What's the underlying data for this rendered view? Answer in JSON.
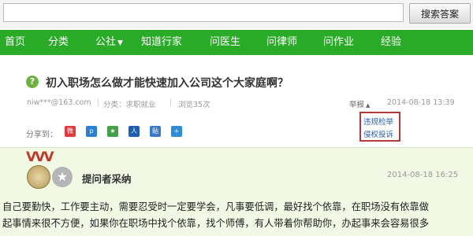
{
  "search": {
    "button_label": "搜索答案",
    "query": ""
  },
  "nav": [
    {
      "label": "首页"
    },
    {
      "label": "分类"
    },
    {
      "label": "公社",
      "arrow": "▼"
    },
    {
      "label": "知道行家"
    },
    {
      "label": "问医生"
    },
    {
      "label": "问律师"
    },
    {
      "label": "问作业"
    },
    {
      "label": "经验"
    }
  ],
  "question": {
    "icon": "?",
    "title": "初入职场怎么做才能快速加入公司这个大家庭啊？",
    "asker": "niw***@163.com",
    "category": "分类：求职就业",
    "views": "浏览35次",
    "report_label": "举报",
    "report_arrow": "▲",
    "time": "2014-08-18 13:39",
    "report_menu": [
      "违规检举",
      "侵权投诉"
    ],
    "share_label": "分享到："
  },
  "share_icons": [
    {
      "name": "weibo-icon",
      "glyph": "微",
      "color": "#e4393c"
    },
    {
      "name": "qzone-icon",
      "glyph": "p",
      "color": "#2a7fd4"
    },
    {
      "name": "qq-weibo-icon",
      "glyph": "★",
      "color": "#43a047"
    },
    {
      "name": "renren-icon",
      "glyph": "人",
      "color": "#1e5fb0"
    },
    {
      "name": "kaixin-icon",
      "glyph": "贴",
      "color": "#3b78c4"
    },
    {
      "name": "more-share-icon",
      "glyph": "+",
      "color": "#2e8bd6"
    }
  ],
  "answer": {
    "badge_label": "提问者采纳",
    "time": "2014-08-18 16:25",
    "lines": [
      "自己要勤快，工作要主动，需要忍受时一定要学会，凡事要低调，最好找个依靠，在职场没有依靠做",
      "起事情来很不方便，如果你在职场中找个依靠，找个师傅，有人带着你帮助你，办起事来会容易很多"
    ]
  }
}
